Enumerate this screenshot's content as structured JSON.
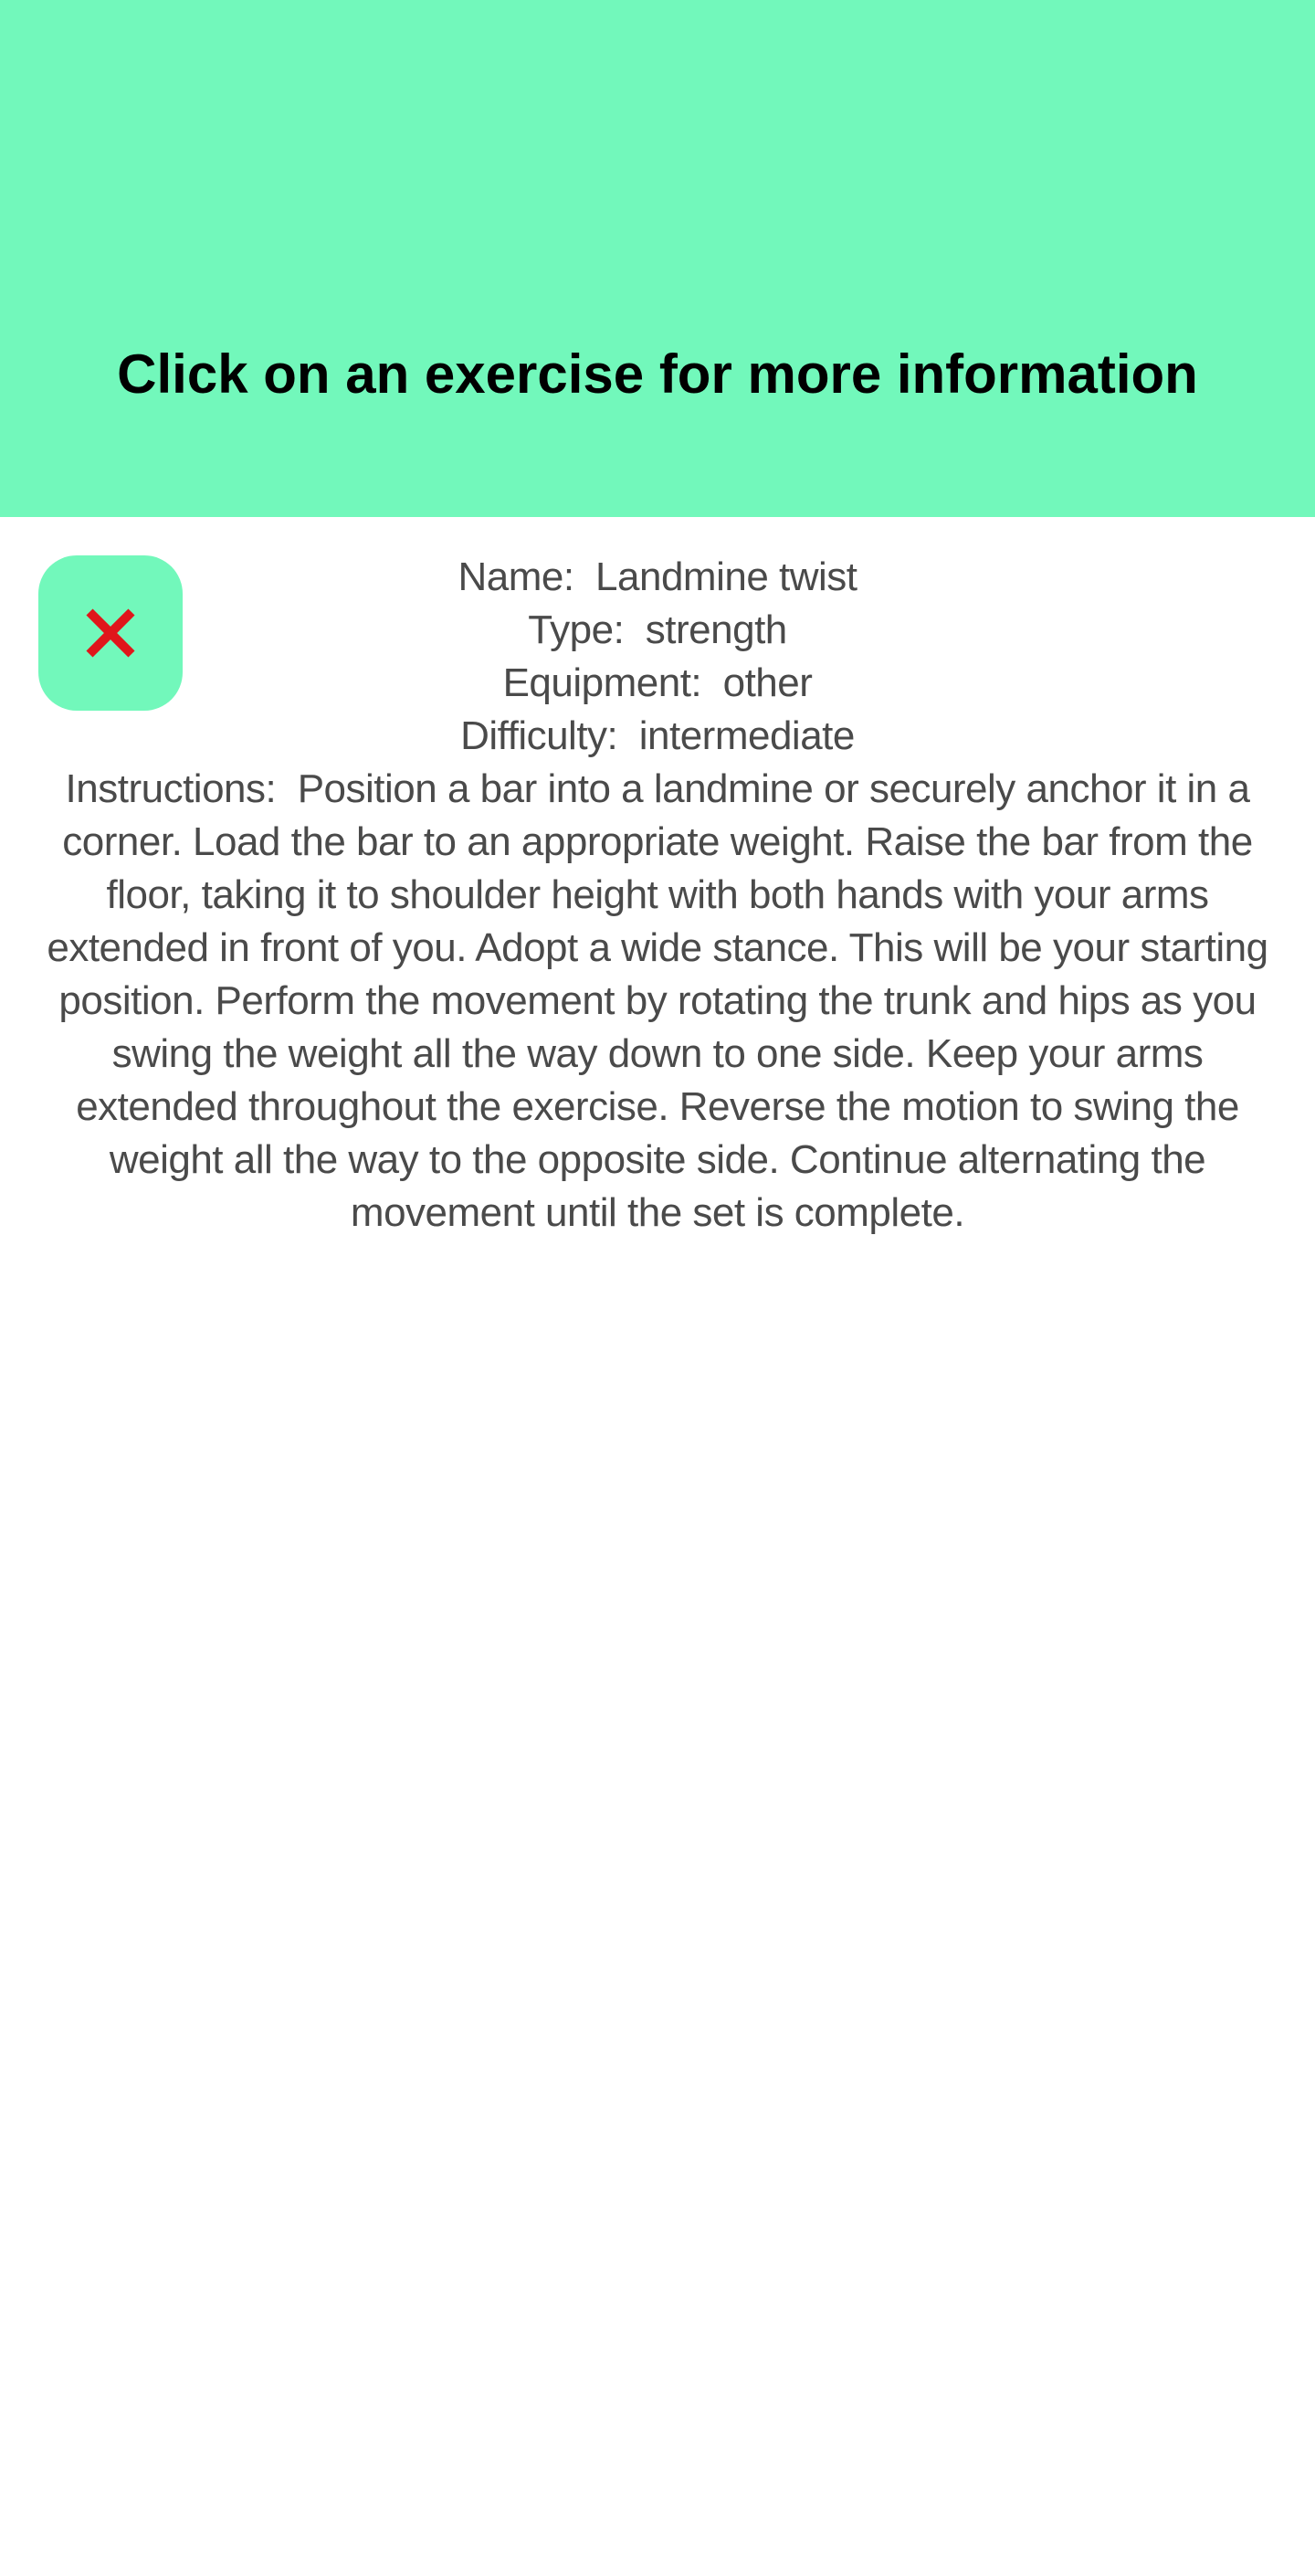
{
  "header": {
    "title": "Click on an exercise for more information"
  },
  "close_button": {
    "icon": "close-icon",
    "icon_color": "#e0161b"
  },
  "exercise": {
    "name_label": "Name:  ",
    "name": "Landmine twist",
    "type_label": "Type:  ",
    "type": "strength",
    "equipment_label": "Equipment:  ",
    "equipment": "other",
    "difficulty_label": "Difficulty:  ",
    "difficulty": "intermediate",
    "instructions_label": "Instructions:  ",
    "instructions": "Position a bar into a landmine or securely anchor it in a corner. Load the bar to an appropriate weight. Raise the bar from the floor, taking it to shoulder height with both hands with your arms extended in front of you. Adopt a wide stance. This will be your starting position. Perform the movement by rotating the trunk and hips as you swing the weight all the way down to one side. Keep your arms extended throughout the exercise. Reverse the motion to swing the weight all the way to the opposite side. Continue alternating the movement until the set is complete."
  },
  "colors": {
    "accent": "#72f8bb",
    "text": "#4a4a4a",
    "close": "#e0161b"
  }
}
